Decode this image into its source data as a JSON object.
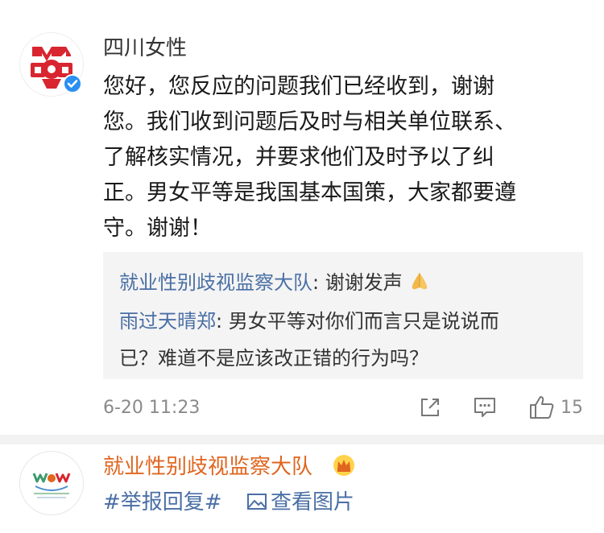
{
  "comment": {
    "author": "四川女性",
    "lines": [
      "您好，您反应的问题我们已经收到，谢谢",
      "您。我们收到问题后及时与相关单位联系、",
      "了解核实情况，并要求他们及时予以了纠",
      "正。男女平等是我国基本国策，大家都要遵",
      "守。谢谢！"
    ],
    "replies": [
      {
        "author": "就业性别歧视监察大队",
        "sep": ": ",
        "text": "谢谢发声"
      },
      {
        "author": "雨过天晴郑",
        "sep": ": ",
        "text": "男女平等对你们而言只是说说而",
        "text_cont": "已？难道不是应该改正错的行为吗？"
      }
    ],
    "timestamp": "6-20 11:23",
    "likes": "15"
  },
  "next_post": {
    "author": "就业性别歧视监察大队",
    "topic": "#举报回复#",
    "view_image": "查看图片"
  },
  "icons": {
    "share": "share-icon",
    "comment": "comment-icon",
    "like": "thumbs-up-icon",
    "verified": "verified-badge-icon",
    "crown": "crown-icon",
    "image": "image-icon"
  },
  "colors": {
    "link": "#4a6fa5",
    "orange_name": "#e0651f",
    "verified": "#2a8ff0",
    "logo_red": "#d8252f"
  }
}
